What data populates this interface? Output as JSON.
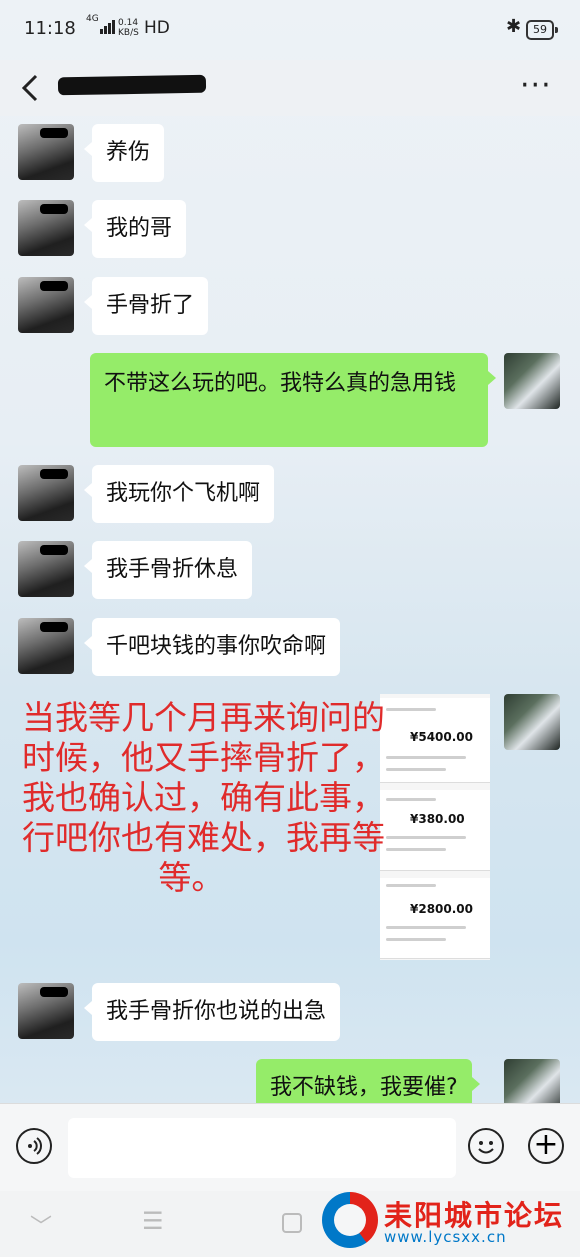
{
  "status_bar": {
    "time": "11:18",
    "network": "4G",
    "speed_value": "0.14",
    "speed_unit": "KB/S",
    "hd": "HD",
    "battery": "59"
  },
  "header": {
    "title": "",
    "more": "···"
  },
  "messages": [
    {
      "side": "in",
      "text": "养伤"
    },
    {
      "side": "in",
      "text": "我的哥"
    },
    {
      "side": "in",
      "text": "手骨折了"
    },
    {
      "side": "out",
      "text": "不带这么玩的吧。我特么真的急用钱"
    },
    {
      "side": "in",
      "text": "我玩你个飞机啊"
    },
    {
      "side": "in",
      "text": "我手骨折休息"
    },
    {
      "side": "in",
      "text": "千吧块钱的事你吹命啊"
    },
    {
      "side": "in",
      "text": "我手骨折你也说的出急"
    },
    {
      "side": "out",
      "text": "我不缺钱，我要催?"
    }
  ],
  "receipts": [
    {
      "amount": "¥5400.00"
    },
    {
      "amount": "¥380.00"
    },
    {
      "amount": "¥2800.00"
    }
  ],
  "overlay_text": "当我等几个月再来询问的\n时候，他又手摔骨折了，\n我也确认过，确有此事，\n行吧你也有难处，我再等\n             等。",
  "input": {
    "placeholder": ""
  },
  "watermark": {
    "title": "耒阳城市论坛",
    "url": "www.lycsxx.cn"
  },
  "colors": {
    "outgoing_bubble": "#95ec69",
    "incoming_bubble": "#ffffff",
    "overlay_text": "#e02b2b"
  }
}
